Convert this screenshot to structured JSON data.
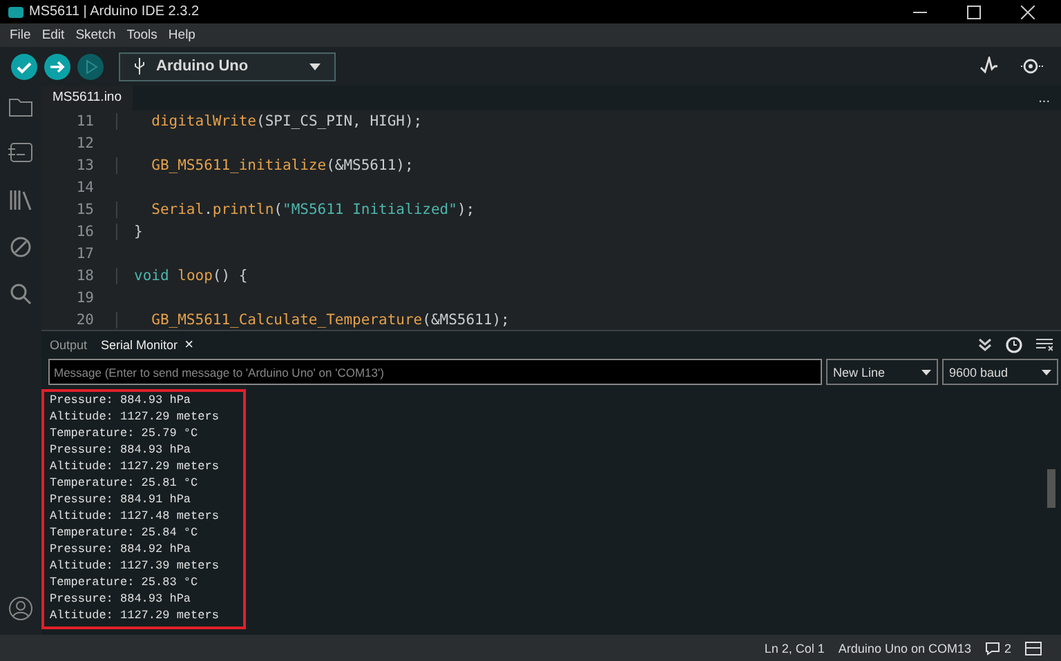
{
  "window": {
    "title": "MS5611 | Arduino IDE 2.3.2"
  },
  "menu": [
    "File",
    "Edit",
    "Sketch",
    "Tools",
    "Help"
  ],
  "toolbar": {
    "board": "Arduino Uno"
  },
  "editor_tabs": [
    {
      "label": "MS5611.ino",
      "selected": true
    }
  ],
  "more": "...",
  "code": [
    {
      "number": "11",
      "tokens": [
        {
          "text": "  digitalWrite",
          "kind": "function"
        },
        {
          "text": "(SPI_CS_PIN, HIGH);",
          "kind": "plain"
        }
      ]
    },
    {
      "number": "12"
    },
    {
      "number": "13",
      "tokens": [
        {
          "text": "  GB_MS5611_initialize",
          "kind": "function"
        },
        {
          "text": "(&MS5611);",
          "kind": "plain"
        }
      ]
    },
    {
      "number": "14"
    },
    {
      "number": "15",
      "tokens": [
        {
          "text": "  Serial",
          "kind": "function"
        },
        {
          "text": ".",
          "kind": "plain"
        },
        {
          "text": "println",
          "kind": "function"
        },
        {
          "text": "(",
          "kind": "plain"
        },
        {
          "text": "\"MS5611 Initialized\"",
          "kind": "string"
        },
        {
          "text": ");",
          "kind": "plain"
        }
      ]
    },
    {
      "number": "16",
      "tokens": [
        {
          "text": "}",
          "kind": "plain"
        }
      ]
    },
    {
      "number": "17"
    },
    {
      "number": "18",
      "tokens": [
        {
          "text": "void",
          "kind": "keyword"
        },
        {
          "text": " loop",
          "kind": "function"
        },
        {
          "text": "() {",
          "kind": "plain"
        }
      ]
    },
    {
      "number": "19"
    },
    {
      "number": "20",
      "tokens": [
        {
          "text": "  GB_MS5611_Calculate_Temperature",
          "kind": "function"
        },
        {
          "text": "(&MS5611);",
          "kind": "plain"
        }
      ]
    }
  ],
  "panel_tabs": [
    {
      "label": "Output",
      "selected": false,
      "closable": false
    },
    {
      "label": "Serial Monitor",
      "selected": true,
      "closable": true
    }
  ],
  "close_glyph": "×",
  "serial": {
    "placeholder": "Message (Enter to send message to 'Arduino Uno' on 'COM13')",
    "line_ending": "New Line",
    "baud": "9600 baud"
  },
  "serial_output": [
    "Pressure: 884.93 hPa",
    "Altitude: 1127.29 meters",
    "Temperature: 25.79 °C",
    "Pressure: 884.93 hPa",
    "Altitude: 1127.29 meters",
    "Temperature: 25.81 °C",
    "Pressure: 884.91 hPa",
    "Altitude: 1127.48 meters",
    "Temperature: 25.84 °C",
    "Pressure: 884.92 hPa",
    "Altitude: 1127.39 meters",
    "Temperature: 25.83 °C",
    "Pressure: 884.93 hPa",
    "Altitude: 1127.29 meters"
  ],
  "status_bar": {
    "position": "Ln 2, Col 1",
    "board": "Arduino Uno on COM13",
    "notifications": "2"
  }
}
